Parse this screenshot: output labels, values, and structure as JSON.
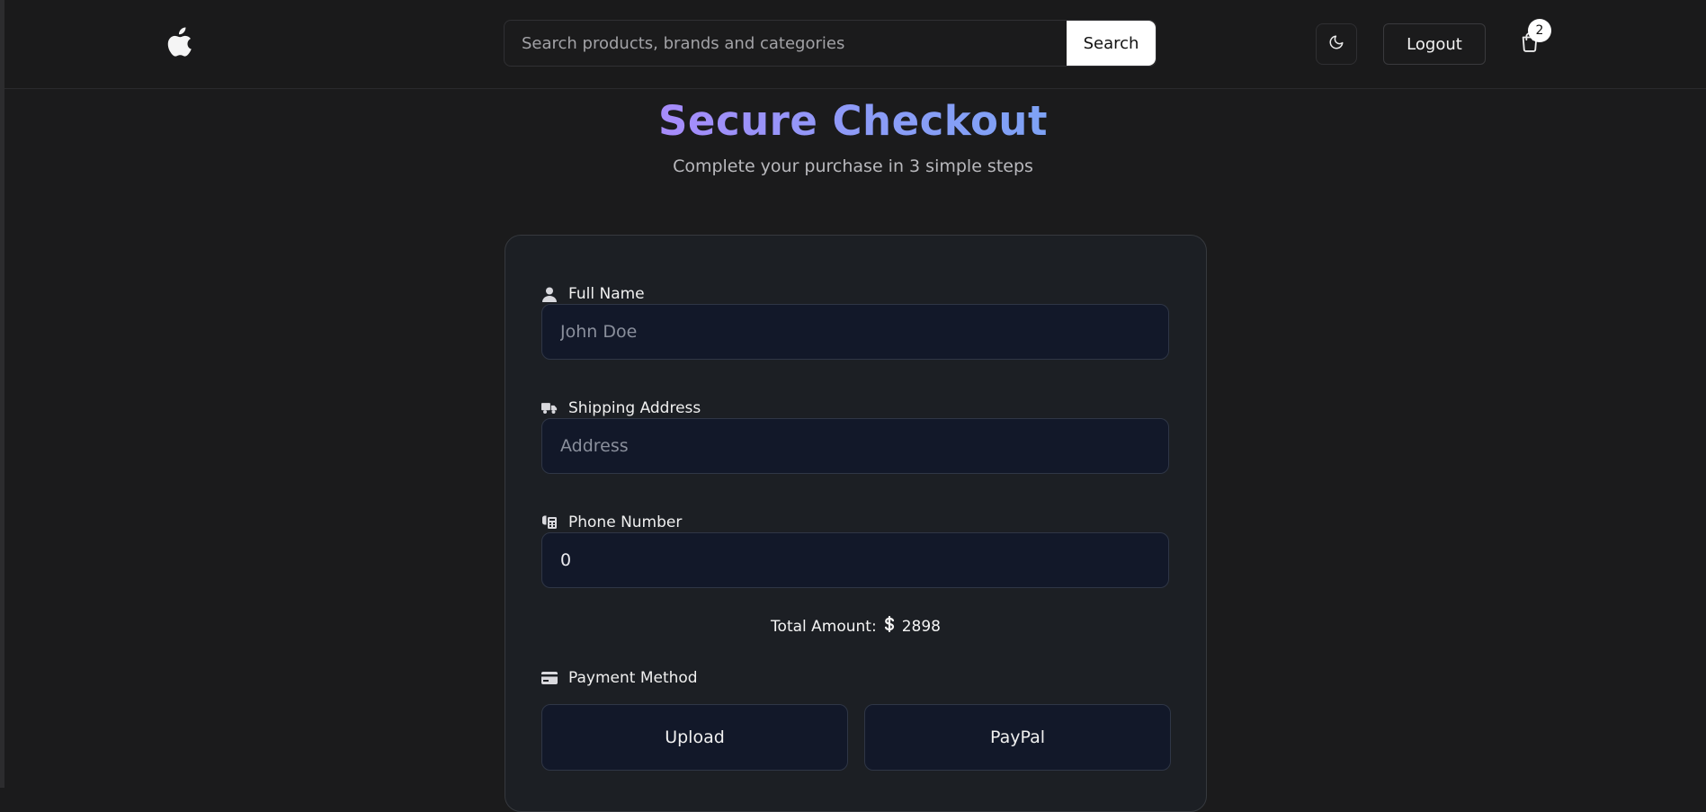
{
  "header": {
    "logo": "apple-logo",
    "search": {
      "placeholder": "Search products, brands and categories",
      "value": "",
      "button_label": "Search"
    },
    "theme_toggle_icon": "moon-icon",
    "logout_label": "Logout",
    "cart_icon": "shopping-bag-icon",
    "cart_count": "2"
  },
  "page": {
    "title": "Secure Checkout",
    "subtitle": "Complete your purchase in 3 simple steps"
  },
  "form": {
    "full_name": {
      "label": "Full Name",
      "icon": "user-icon",
      "placeholder": "John Doe",
      "value": ""
    },
    "address": {
      "label": "Shipping Address",
      "icon": "truck-icon",
      "placeholder": "Address",
      "value": ""
    },
    "phone": {
      "label": "Phone Number",
      "icon": "phone-icon",
      "placeholder": "",
      "value": "0"
    },
    "total": {
      "label": "Total Amount:",
      "currency_icon": "dollar-icon",
      "amount": "2898"
    },
    "payment": {
      "label": "Payment Method",
      "icon": "credit-card-icon",
      "options": [
        "Upload",
        "PayPal"
      ]
    }
  },
  "colors": {
    "background": "#1b1b1c",
    "card": "#1c1f24",
    "input": "#121829",
    "title_gradient_start": "#a78bfa",
    "title_gradient_end": "#7ea2f5"
  }
}
